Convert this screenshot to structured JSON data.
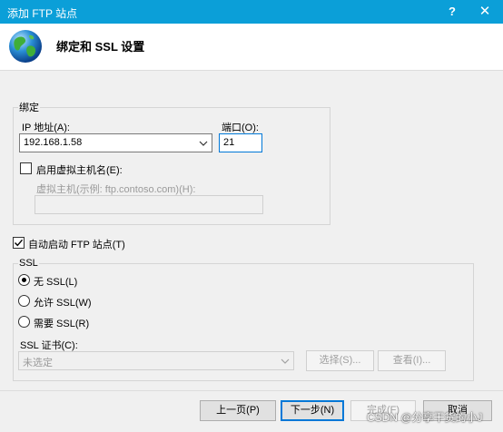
{
  "window": {
    "title": "添加 FTP 站点",
    "help_glyph": "?",
    "close_glyph": "✕"
  },
  "header": {
    "title": "绑定和 SSL 设置"
  },
  "binding": {
    "group_label": "绑定",
    "ip_label": "IP 地址(A):",
    "ip_value": "192.168.1.58",
    "port_label": "端口(O):",
    "port_value": "21",
    "virtual_host_checkbox_label": "启用虚拟主机名(E):",
    "virtual_host_checked": false,
    "virtual_host_label": "虚拟主机(示例: ftp.contoso.com)(H):",
    "virtual_host_value": ""
  },
  "auto_start": {
    "label": "自动启动 FTP 站点(T)",
    "checked": true
  },
  "ssl": {
    "group_label": "SSL",
    "options": [
      {
        "label": "无 SSL(L)",
        "selected": true
      },
      {
        "label": "允许 SSL(W)",
        "selected": false
      },
      {
        "label": "需要 SSL(R)",
        "selected": false
      }
    ],
    "cert_label": "SSL 证书(C):",
    "cert_value": "未选定",
    "select_button": "选择(S)...",
    "view_button": "查看(I)..."
  },
  "footer": {
    "prev_button": "上一页(P)",
    "next_button": "下一步(N)",
    "finish_button": "完成(F)",
    "cancel_button": "取消"
  },
  "watermark": "CSDN @分享干货的小J",
  "colors": {
    "titlebar": "#0b9fd8",
    "accent": "#0078d7"
  }
}
